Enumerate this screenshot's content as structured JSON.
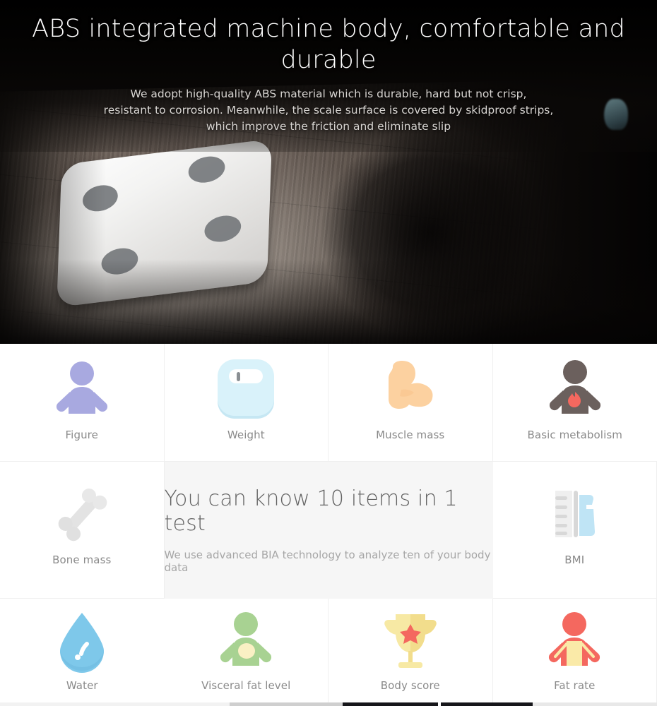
{
  "hero": {
    "title": "ABS integrated machine body, comfortable and durable",
    "sub_line1": "We adopt high-quality ABS material which is durable, hard but not crisp,",
    "sub_line2": "resistant to corrosion. Meanwhile, the scale surface is covered by skidproof strips,",
    "sub_line3": "which improve the friction and eliminate slip",
    "title_color": "#ffffff",
    "sub_color": "#d8d5d2",
    "background_color": "#0a0706",
    "product_image": "smart-body-fat-scale-on-wood-floor"
  },
  "promo": {
    "title": "You can know 10 items in 1 test",
    "subtitle": "We use advanced BIA technology to analyze ten of your body data",
    "background_color": "#f6f6f6",
    "title_color": "#636363",
    "subtitle_color": "#a6a6a6"
  },
  "grid": {
    "label_color": "#8a8a8a",
    "divider_color": "#efefef",
    "items": [
      {
        "label": "Figure",
        "icon": "person-figure-icon",
        "color": "#a8a9e0"
      },
      {
        "label": "Weight",
        "icon": "scale-icon",
        "color": "#d4eef7"
      },
      {
        "label": "Muscle mass",
        "icon": "flexed-bicep-icon",
        "color": "#fcd1a0"
      },
      {
        "label": "Basic metabolism",
        "icon": "person-flame-icon",
        "color": "#6b605d"
      },
      {
        "label": "Bone mass",
        "icon": "bone-icon",
        "color": "#e3e3e3"
      },
      {
        "label": "BMI",
        "icon": "ruler-body-icon",
        "color": "#bfe4f5"
      },
      {
        "label": "Water",
        "icon": "water-drop-icon",
        "color": "#7ec8ea"
      },
      {
        "label": "Visceral fat level",
        "icon": "person-belly-icon",
        "color": "#a8d292"
      },
      {
        "label": "Body score",
        "icon": "trophy-star-icon",
        "color": "#f7e9a4"
      },
      {
        "label": "Fat rate",
        "icon": "person-fat-rate-icon",
        "color": "#f4685f"
      }
    ]
  }
}
